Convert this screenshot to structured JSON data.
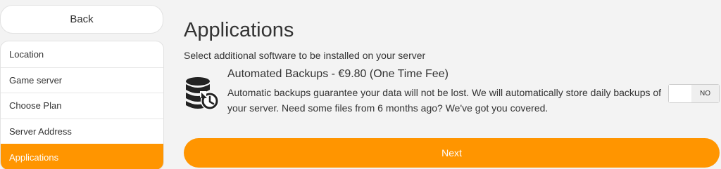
{
  "sidebar": {
    "back_label": "Back",
    "items": [
      {
        "label": "Location"
      },
      {
        "label": "Game server"
      },
      {
        "label": "Choose Plan"
      },
      {
        "label": "Server Address"
      },
      {
        "label": "Applications"
      }
    ],
    "active_index": 4
  },
  "main": {
    "title": "Applications",
    "subtitle": "Select additional software to be installed on your server",
    "app": {
      "icon": "database-restore-icon",
      "name": "Automated Backups - €9.80 (One Time Fee)",
      "description": "Automatic backups guarantee your data will not be lost. We will automatically store daily backups of your server. Need some files from 6 months ago? We've got you covered.",
      "toggle_label": "NO",
      "enabled": false
    },
    "next_label": "Next"
  },
  "colors": {
    "accent": "#ff9500",
    "background": "#f3f3f3",
    "text": "#333333"
  }
}
